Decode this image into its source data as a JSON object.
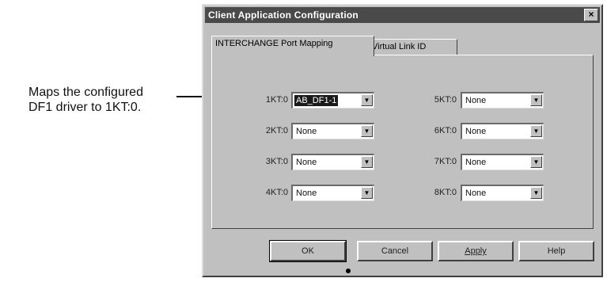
{
  "callout": {
    "line1": "Maps the configured",
    "line2": "DF1 driver to 1KT:0."
  },
  "dialog": {
    "title": "Client Application Configuration",
    "close_glyph": "×",
    "tabs": [
      {
        "label": "INTERCHANGE Port Mapping",
        "active": true
      },
      {
        "label": "Virtual Link ID",
        "active": false
      }
    ],
    "ports": [
      {
        "label": "1KT:0",
        "value": "AB_DF1-1",
        "selected": true
      },
      {
        "label": "2KT:0",
        "value": "None"
      },
      {
        "label": "3KT:0",
        "value": "None"
      },
      {
        "label": "4KT:0",
        "value": "None"
      },
      {
        "label": "5KT:0",
        "value": "None"
      },
      {
        "label": "6KT:0",
        "value": "None"
      },
      {
        "label": "7KT:0",
        "value": "None"
      },
      {
        "label": "8KT:0",
        "value": "None"
      }
    ],
    "dropdown_glyph": "▼",
    "buttons": {
      "ok": "OK",
      "cancel": "Cancel",
      "apply": "Apply",
      "help": "Help"
    }
  }
}
